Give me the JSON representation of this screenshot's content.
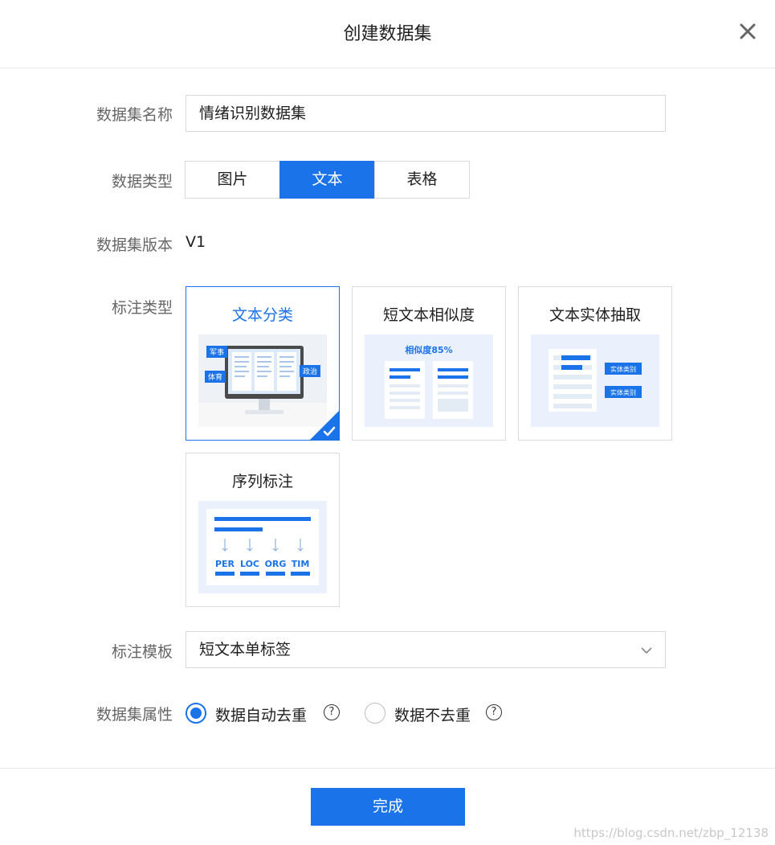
{
  "dialog": {
    "title": "创建数据集",
    "close_icon": "close-icon"
  },
  "form": {
    "name": {
      "label": "数据集名称",
      "value": "情绪识别数据集"
    },
    "type": {
      "label": "数据类型",
      "options": [
        "图片",
        "文本",
        "表格"
      ],
      "selected": "文本"
    },
    "version": {
      "label": "数据集版本",
      "value": "V1"
    },
    "annotation": {
      "label": "标注类型",
      "cards": [
        {
          "title": "文本分类",
          "selected": true,
          "tags": [
            "军事",
            "体育",
            "政治"
          ]
        },
        {
          "title": "短文本相似度",
          "selected": false,
          "caption": "相似度85%"
        },
        {
          "title": "文本实体抽取",
          "selected": false,
          "tags": [
            "实体类别",
            "实体类别"
          ]
        },
        {
          "title": "序列标注",
          "selected": false,
          "tags": [
            "PER",
            "LOC",
            "ORG",
            "TIM"
          ]
        }
      ]
    },
    "template": {
      "label": "标注模板",
      "value": "短文本单标签",
      "icon": "chevron-down-icon"
    },
    "attribute": {
      "label": "数据集属性",
      "options": [
        {
          "label": "数据自动去重",
          "checked": true
        },
        {
          "label": "数据不去重",
          "checked": false
        }
      ],
      "help_glyph": "?"
    }
  },
  "footer": {
    "done_label": "完成"
  },
  "watermark": "https://blog.csdn.net/zbp_12138",
  "colors": {
    "accent": "#1a73e8",
    "border": "#d9d9d9",
    "label": "#666666"
  }
}
